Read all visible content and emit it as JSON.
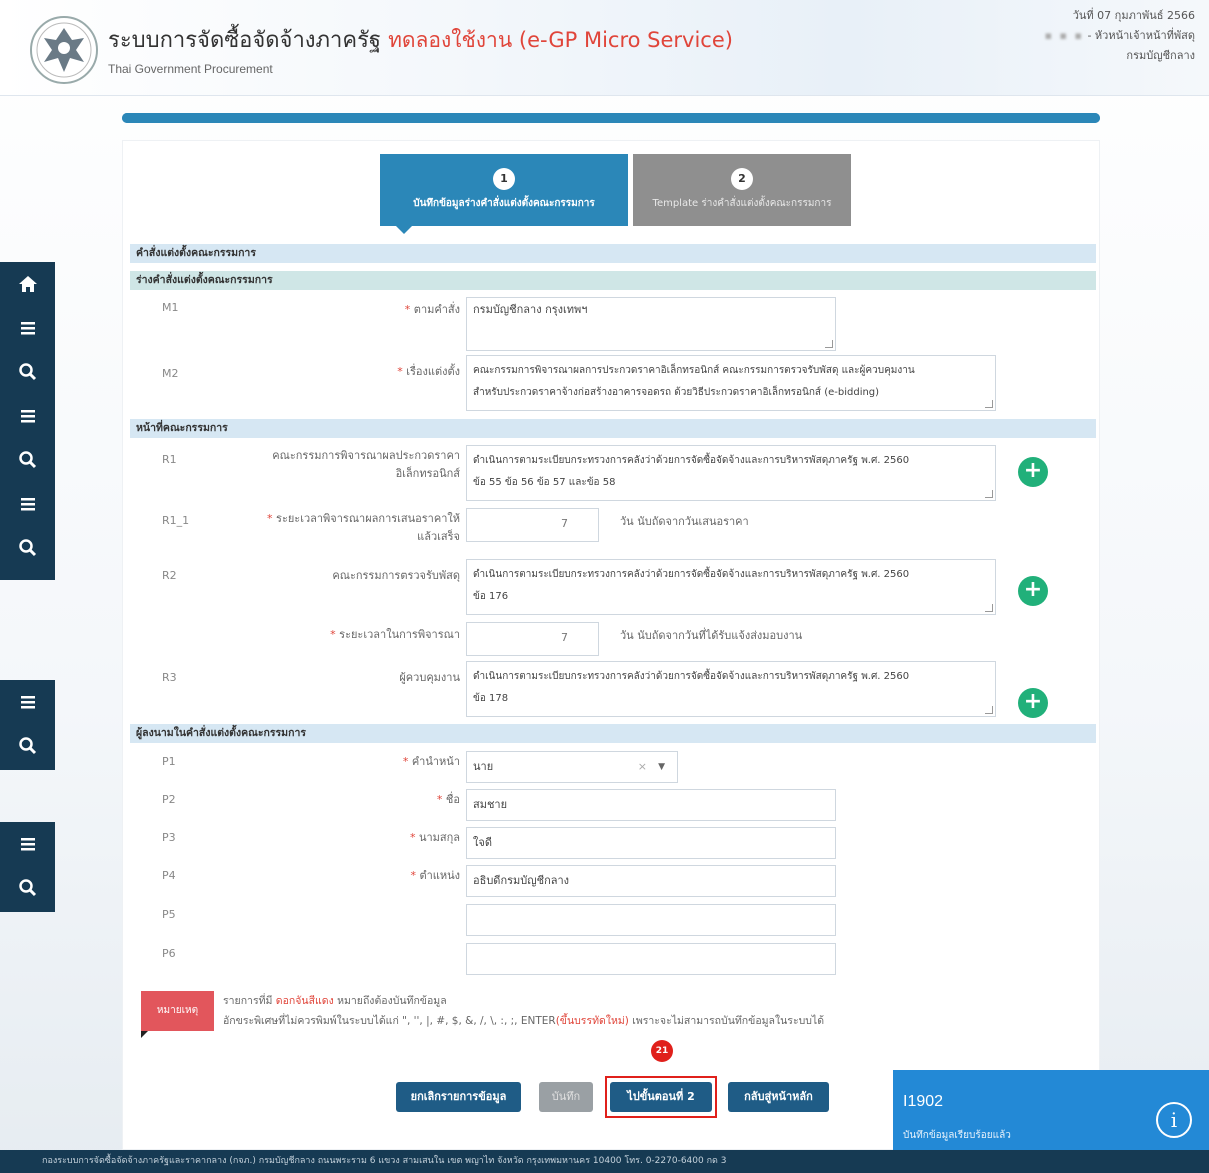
{
  "header": {
    "title": "ระบบการจัดซื้อจัดจ้างภาครัฐ",
    "trial_label": "ทดลองใช้งาน (e-GP Micro Service)",
    "subtitle": "Thai Government Procurement",
    "date": "วันที่ 07 กุมภาพันธ์ 2566",
    "user_role": "- หัวหน้าเจ้าหน้าที่พัสดุ",
    "department": "กรมบัญชีกลาง"
  },
  "progress": 1.0,
  "wizard": {
    "steps": [
      {
        "num": "1",
        "label": "บันทึกข้อมูลร่างคำสั่งแต่งตั้งคณะกรรมการ"
      },
      {
        "num": "2",
        "label": "Template ร่างคำสั่งแต่งตั้งคณะกรรมการ"
      }
    ]
  },
  "sections": {
    "order": "คำสั่งแต่งตั้งคณะกรรมการ",
    "draft": "ร่างคำสั่งแต่งตั้งคณะกรรมการ",
    "duties": "หน้าที่คณะกรรมการ",
    "signer": "ผู้ลงนามในคำสั่งแต่งตั้งคณะกรรมการ"
  },
  "fields": {
    "m1": {
      "code": "M1",
      "label": "ตามคำสั่ง",
      "value": "กรมบัญชีกลาง กรุงเทพฯ"
    },
    "m2": {
      "code": "M2",
      "label": "เรื่องแต่งตั้ง",
      "value_line1": "คณะกรรมการพิจารณาผลการประกวดราคาอิเล็กทรอนิกส์ คณะกรรมการตรวจรับพัสดุ และผู้ควบคุมงาน",
      "value_line2": "สำหรับประกวดราคาจ้างก่อสร้างอาคารจอดรถ ด้วยวิธีประกวดราคาอิเล็กทรอนิกส์ (e-bidding)"
    },
    "r1": {
      "code": "R1",
      "label_line1": "คณะกรรมการพิจารณาผลประกวดราคา",
      "label_line2": "อิเล็กทรอนิกส์",
      "value_line1": "ดำเนินการตามระเบียบกระทรวงการคลังว่าด้วยการจัดซื้อจัดจ้างและการบริหารพัสดุภาครัฐ   พ.ศ. 2560",
      "value_line2": "ข้อ 55 ข้อ 56 ข้อ 57 และข้อ 58"
    },
    "r1_1": {
      "code": "R1_1",
      "label_line1": "ระยะเวลาพิจารณาผลการเสนอราคาให้",
      "label_line2": "แล้วเสร็จ",
      "value": "7",
      "unit": "วัน นับถัดจากวันเสนอราคา"
    },
    "r2": {
      "code": "R2",
      "label": "คณะกรรมการตรวจรับพัสดุ",
      "value_line1": "ดำเนินการตามระเบียบกระทรวงการคลังว่าด้วยการจัดซื้อจัดจ้างและการบริหารพัสดุภาครัฐ   พ.ศ. 2560",
      "value_line2": "ข้อ 176"
    },
    "r2_time": {
      "label": "ระยะเวลาในการพิจารณา",
      "value": "7",
      "unit": "วัน นับถัดจากวันที่ได้รับแจ้งส่งมอบงาน"
    },
    "r3": {
      "code": "R3",
      "label": "ผู้ควบคุมงาน",
      "value_line1": "ดำเนินการตามระเบียบกระทรวงการคลังว่าด้วยการจัดซื้อจัดจ้างและการบริหารพัสดุภาครัฐ   พ.ศ. 2560",
      "value_line2": "ข้อ 178"
    },
    "p1": {
      "code": "P1",
      "label": "คำนำหน้า",
      "value": "นาย",
      "clear": "×",
      "caret": "▼"
    },
    "p2": {
      "code": "P2",
      "label": "ชื่อ",
      "value": "สมชาย"
    },
    "p3": {
      "code": "P3",
      "label": "นามสกุล",
      "value": "ใจดี"
    },
    "p4": {
      "code": "P4",
      "label": "ตำแหน่ง",
      "value": "อธิบดีกรมบัญชีกลาง"
    },
    "p5": {
      "code": "P5",
      "value": ""
    },
    "p6": {
      "code": "P6",
      "value": ""
    }
  },
  "required_mark": "*",
  "plus_symbol": "+",
  "note": {
    "badge": "หมายเหตุ",
    "line1_prefix": "รายการที่มี",
    "line1_red": "ดอกจันสีแดง",
    "line1_suffix": "หมายถึงต้องบันทึกข้อมูล",
    "line2_prefix": "อักขระพิเศษที่ไม่ควรพิมพ์ในระบบได้แก่ \", '', |, #, $, &, /, \\, :, ;, ENTER",
    "line2_red": "(ขึ้นบรรทัดใหม่)",
    "line2_suffix": "เพราะจะไม่สามารถบันทึกข้อมูลในระบบได้"
  },
  "buttons": {
    "cancel": "ยกเลิกรายการข้อมูล",
    "save": "บันทึก",
    "next": "ไปขั้นตอนที่ 2",
    "home": "กลับสู่หน้าหลัก"
  },
  "step_marker": "21",
  "toast": {
    "code": "I1902",
    "message": "บันทึกข้อมูลเรียบร้อยแล้ว",
    "icon": "i"
  },
  "footer": "กองระบบการจัดซื้อจัดจ้างภาครัฐและราคากลาง (กจภ.) กรมบัญชีกลาง ถนนพระราม 6 แขวง สามเสนใน เขต พญาไท จังหวัด กรุงเทพมหานคร 10400 โทร. 0-2270-6400 กด 3",
  "colors": {
    "accent": "#2b87b8",
    "navy": "#1f5c86",
    "sidebar": "#163a53",
    "required": "#e0453a",
    "success": "#21b07a",
    "toast": "#2389d6"
  }
}
